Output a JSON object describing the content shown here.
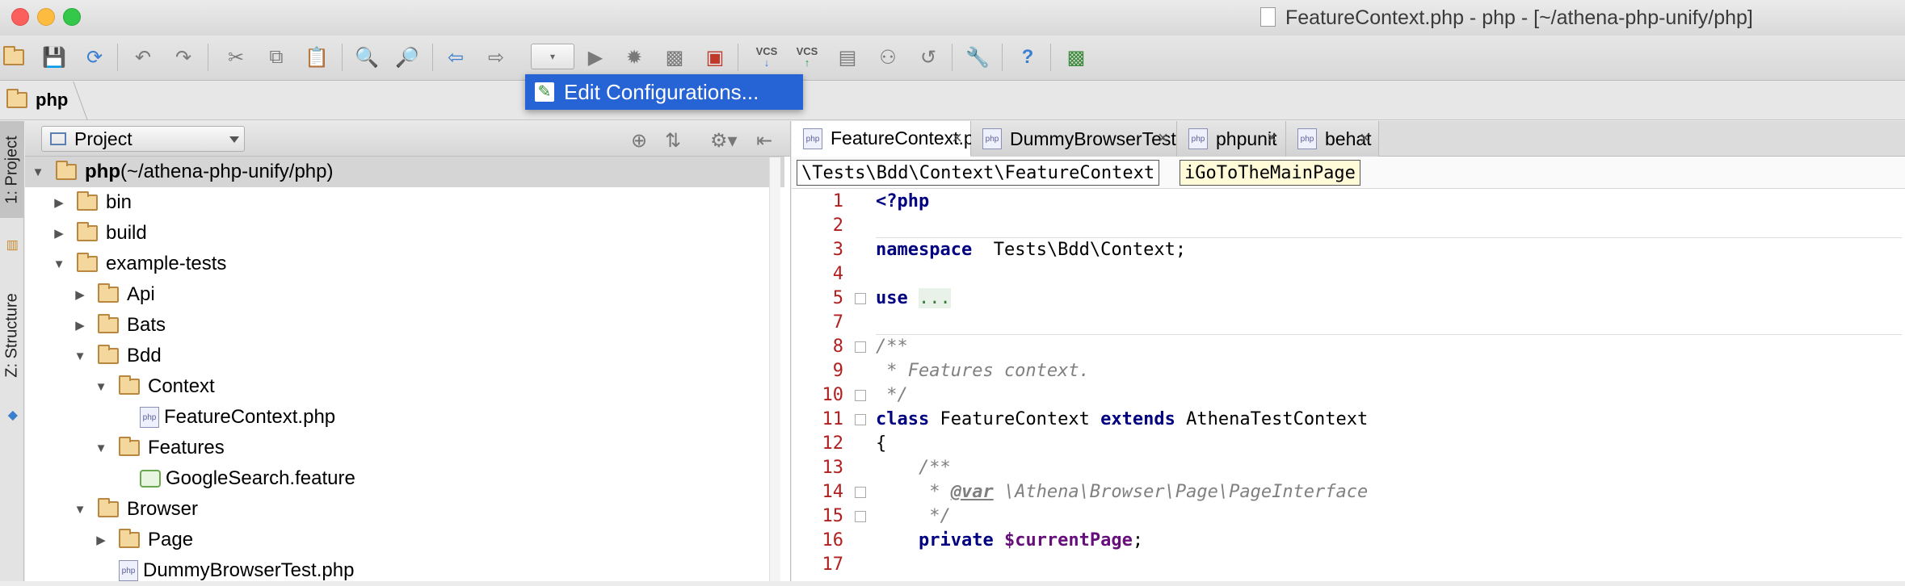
{
  "window": {
    "title": "FeatureContext.php - php - [~/athena-php-unify/php]"
  },
  "toolbar": {
    "icons": [
      "open-folder-icon",
      "save-icon",
      "sync-icon",
      "undo-icon",
      "redo-icon",
      "cut-icon",
      "copy-icon",
      "paste-icon",
      "find-icon",
      "replace-icon",
      "back-icon",
      "forward-icon",
      "run-config-combo",
      "run-icon",
      "debug-icon",
      "coverage-icon",
      "stop-icon",
      "vcs-update-icon",
      "vcs-commit-icon",
      "vcs-history-icon",
      "vcs-annotate-icon",
      "revert-icon",
      "settings-icon",
      "help-icon",
      "sdk-icon"
    ],
    "vcs_label": "VCS",
    "help": "?"
  },
  "popup": {
    "label": "Edit Configurations..."
  },
  "navbar": {
    "crumb": "php"
  },
  "leftbar": {
    "tab_project": "1: Project",
    "tab_structure": "Z: Structure"
  },
  "project": {
    "selector": "Project",
    "tree": [
      {
        "name": "php",
        "suffix": " (~/athena-php-unify/php)",
        "type": "folder",
        "expanded": true,
        "level": 0
      },
      {
        "name": "bin",
        "type": "folder",
        "expanded": false,
        "level": 1
      },
      {
        "name": "build",
        "type": "folder",
        "expanded": false,
        "level": 1
      },
      {
        "name": "example-tests",
        "type": "folder",
        "expanded": true,
        "level": 1
      },
      {
        "name": "Api",
        "type": "folder",
        "expanded": false,
        "level": 2
      },
      {
        "name": "Bats",
        "type": "folder",
        "expanded": false,
        "level": 2
      },
      {
        "name": "Bdd",
        "type": "folder",
        "expanded": true,
        "level": 2
      },
      {
        "name": "Context",
        "type": "folder",
        "expanded": true,
        "level": 3
      },
      {
        "name": "FeatureContext.php",
        "type": "php",
        "level": 4
      },
      {
        "name": "Features",
        "type": "folder",
        "expanded": true,
        "level": 3
      },
      {
        "name": "GoogleSearch.feature",
        "type": "feature",
        "level": 4
      },
      {
        "name": "Browser",
        "type": "folder",
        "expanded": true,
        "level": 2
      },
      {
        "name": "Page",
        "type": "folder",
        "expanded": false,
        "level": 3
      },
      {
        "name": "DummyBrowserTest.php",
        "type": "php",
        "level": 3
      }
    ]
  },
  "editor": {
    "tabs": [
      {
        "label": "FeatureContext.php",
        "active": true
      },
      {
        "label": "DummyBrowserTest.php",
        "active": false
      },
      {
        "label": "phpunit",
        "active": false
      },
      {
        "label": "behat",
        "active": false
      }
    ],
    "breadcrumb": [
      "\\Tests\\Bdd\\Context\\FeatureContext",
      "iGoToTheMainPage"
    ],
    "line_numbers": [
      "1",
      "2",
      "3",
      "4",
      "5",
      "7",
      "8",
      "9",
      "10",
      "11",
      "12",
      "13",
      "14",
      "15",
      "16",
      "17"
    ],
    "code": [
      {
        "parts": [
          [
            "kw",
            "<?php"
          ]
        ]
      },
      {
        "parts": []
      },
      {
        "parts": [
          [
            "kw",
            "namespace"
          ],
          [
            "",
            "  Tests\\Bdd\\Context;"
          ]
        ]
      },
      {
        "parts": []
      },
      {
        "parts": [
          [
            "kw",
            "use"
          ],
          [
            "",
            " "
          ],
          [
            "useblk",
            "..."
          ]
        ]
      },
      {
        "parts": []
      },
      {
        "parts": [
          [
            "cm",
            "/**"
          ]
        ]
      },
      {
        "parts": [
          [
            "cm",
            " * Features context."
          ]
        ]
      },
      {
        "parts": [
          [
            "cm",
            " */"
          ]
        ]
      },
      {
        "parts": [
          [
            "kw",
            "class"
          ],
          [
            "",
            " FeatureContext "
          ],
          [
            "kw",
            "extends"
          ],
          [
            "",
            " AthenaTestContext"
          ]
        ]
      },
      {
        "parts": [
          [
            "",
            "{"
          ]
        ]
      },
      {
        "parts": [
          [
            "cm",
            "    /**"
          ]
        ]
      },
      {
        "parts": [
          [
            "cm",
            "     * "
          ],
          [
            "tag",
            "@var"
          ],
          [
            "cm",
            " \\Athena\\Browser\\Page\\PageInterface"
          ]
        ]
      },
      {
        "parts": [
          [
            "cm",
            "     */"
          ]
        ]
      },
      {
        "parts": [
          [
            "kw",
            "    private"
          ],
          [
            "",
            " "
          ],
          [
            "var",
            "$currentPage"
          ],
          [
            "",
            ";"
          ]
        ]
      },
      {
        "parts": []
      }
    ]
  }
}
